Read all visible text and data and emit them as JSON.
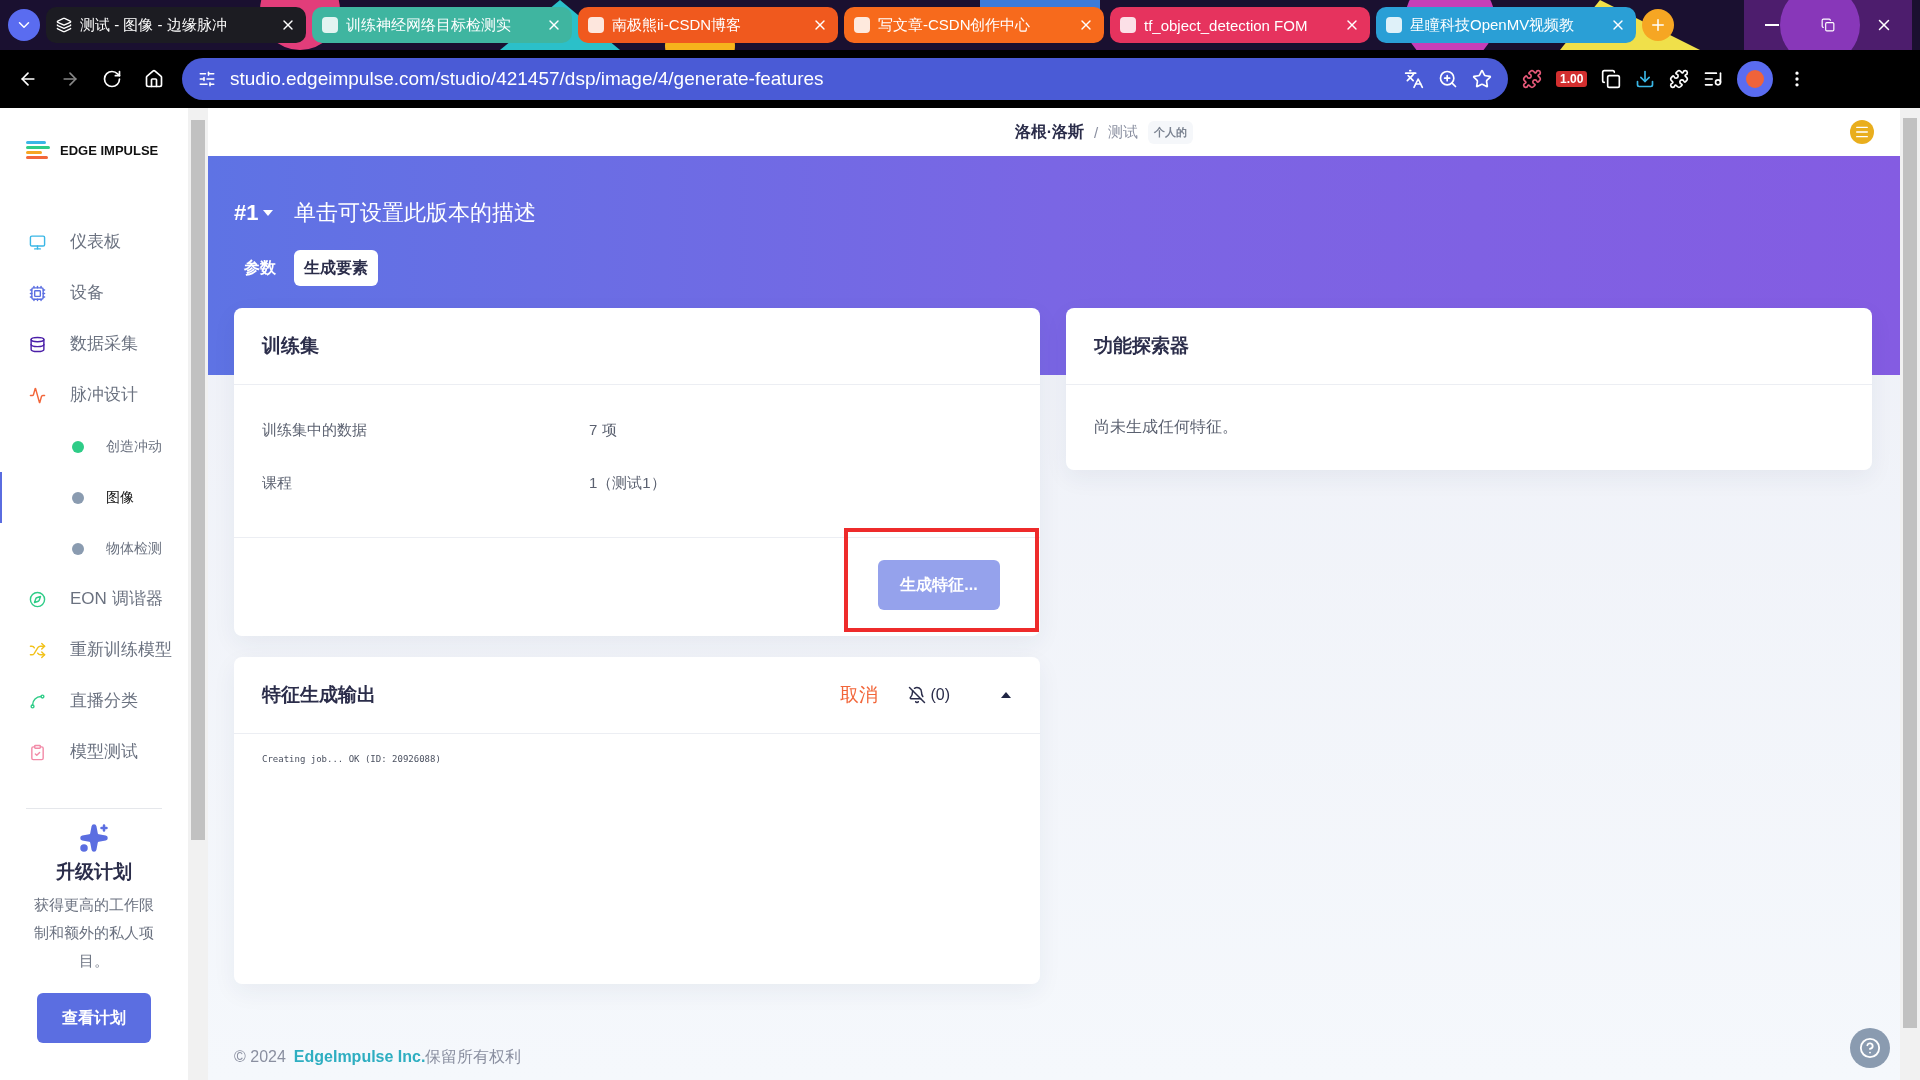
{
  "browser": {
    "tabs": [
      {
        "title": "测试 - 图像 - 边缘脉冲",
        "selected": true
      },
      {
        "title": "训练神经网络目标检测实",
        "selected": false,
        "color": "#3fb5a0"
      },
      {
        "title": "南极熊ii-CSDN博客",
        "selected": false,
        "color": "#f0591e"
      },
      {
        "title": "写文章-CSDN创作中心",
        "selected": false,
        "color": "#f76a1c"
      },
      {
        "title": "tf_object_detection FOM",
        "selected": false,
        "color": "#e6335e"
      },
      {
        "title": "星瞳科技OpenMV视频教",
        "selected": false,
        "color": "#2a9fd6"
      }
    ],
    "url": "studio.edgeimpulse.com/studio/421457/dsp/image/4/generate-features",
    "extension_badge": "1.00"
  },
  "sidebar": {
    "logo": "EDGE IMPULSE",
    "items": [
      {
        "kind": "main",
        "label": "仪表板",
        "selected": false
      },
      {
        "kind": "main",
        "label": "设备",
        "selected": false
      },
      {
        "kind": "main",
        "label": "数据采集",
        "selected": false
      },
      {
        "kind": "main",
        "label": "脉冲设计",
        "selected": false
      },
      {
        "kind": "sub",
        "label": "创造冲动",
        "selected": false,
        "color": "#2ecc87"
      },
      {
        "kind": "sub",
        "label": "图像",
        "selected": true,
        "color": "#8a9bb0"
      },
      {
        "kind": "sub",
        "label": "物体检测",
        "selected": false,
        "color": "#8a9bb0"
      },
      {
        "kind": "main",
        "label": "EON 调谐器",
        "selected": false
      },
      {
        "kind": "main",
        "label": "重新训练模型",
        "selected": false
      },
      {
        "kind": "main",
        "label": "直播分类",
        "selected": false
      },
      {
        "kind": "main",
        "label": "模型测试",
        "selected": false
      }
    ],
    "upgrade": {
      "title": "升级计划",
      "text": "获得更高的工作限制和额外的私人项目。",
      "button": "查看计划"
    }
  },
  "header": {
    "owner": "洛根·洛斯",
    "separator": "/",
    "project": "测试",
    "badge": "个人的"
  },
  "banner": {
    "version": "#1",
    "description": "单击可设置此版本的描述",
    "tabs": [
      {
        "label": "参数",
        "selected": false
      },
      {
        "label": "生成要素",
        "selected": true
      }
    ]
  },
  "training_set": {
    "title": "训练集",
    "rows": [
      {
        "label": "训练集中的数据",
        "value": "7 项"
      },
      {
        "label": "课程",
        "value": "1（测试1）"
      }
    ],
    "button": {
      "label": "生成特征...",
      "disabled": true,
      "highlighted": true
    }
  },
  "feature_explorer": {
    "title": "功能探索器",
    "message": "尚未生成任何特征。"
  },
  "output": {
    "title": "特征生成输出",
    "cancel": "取消",
    "notifications": "(0)",
    "log": "Creating job... OK (ID: 20926088)"
  },
  "footer": {
    "copyright": "© 2024",
    "company": "EdgeImpulse Inc.",
    "rights": "保留所有权利"
  }
}
